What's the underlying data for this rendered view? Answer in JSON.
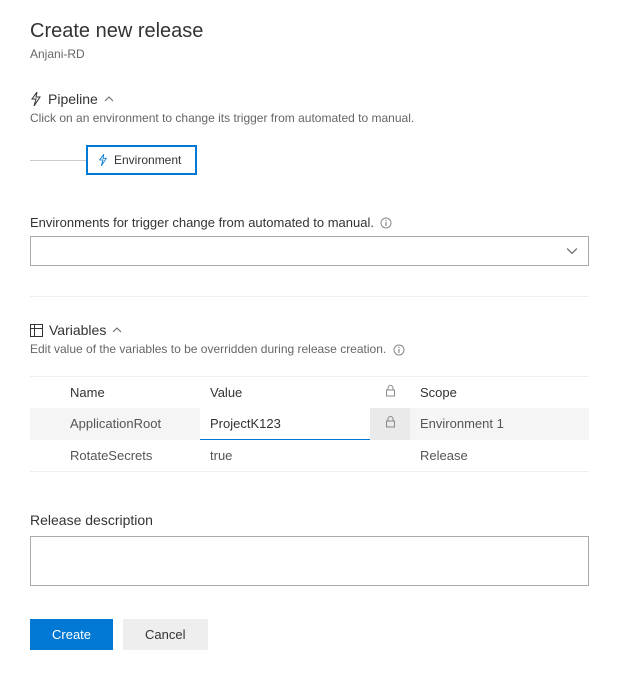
{
  "header": {
    "title": "Create new release",
    "subtitle": "Anjani-RD"
  },
  "pipeline": {
    "title": "Pipeline",
    "description": "Click on an environment to change its trigger from automated to manual.",
    "env_box_label": "Environment"
  },
  "trigger": {
    "label": "Environments for trigger change from automated to manual."
  },
  "variables": {
    "title": "Variables",
    "description": "Edit value of the variables to be overridden during release creation.",
    "columns": {
      "name": "Name",
      "value": "Value",
      "scope": "Scope"
    },
    "rows": [
      {
        "name": "ApplicationRoot",
        "value": "ProjectK123",
        "scope": "Environment 1",
        "locked": true,
        "active": true
      },
      {
        "name": "RotateSecrets",
        "value": "true",
        "scope": "Release",
        "locked": false,
        "active": false
      }
    ]
  },
  "release_desc": {
    "label": "Release description",
    "value": ""
  },
  "buttons": {
    "create": "Create",
    "cancel": "Cancel"
  }
}
